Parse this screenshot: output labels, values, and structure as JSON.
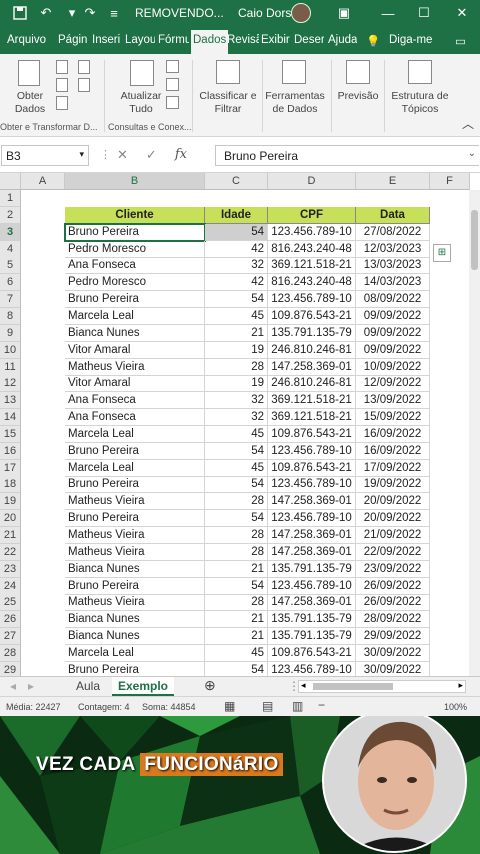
{
  "window": {
    "title": "REMOVENDO...",
    "user": "Caio Dors"
  },
  "tabs": [
    "Arquivo",
    "Págin",
    "Inseri",
    "Layou",
    "Fórmu",
    "Dados",
    "Revisã",
    "Exibir",
    "Deser",
    "Ajuda",
    "Diga-me"
  ],
  "ribbon": {
    "obter_dados": "Obter Dados",
    "atualizar_tudo": "Atualizar Tudo",
    "classificar": "Classificar e Filtrar",
    "ferramentas": "Ferramentas de Dados",
    "previsao": "Previsão",
    "estrutura": "Estrutura de Tópicos",
    "group_obter": "Obter e Transformar D...",
    "group_consultas": "Consultas e Conex..."
  },
  "formula_bar": {
    "name_box": "B3",
    "content": "Bruno Pereira"
  },
  "columns": [
    "A",
    "B",
    "C",
    "D",
    "E",
    "F"
  ],
  "table": {
    "headers": [
      "Cliente",
      "Idade",
      "CPF",
      "Data"
    ],
    "rows": [
      [
        "Bruno Pereira",
        "54",
        "123.456.789-10",
        "27/08/2022"
      ],
      [
        "Pedro Moresco",
        "42",
        "816.243.240-48",
        "12/03/2023"
      ],
      [
        "Ana Fonseca",
        "32",
        "369.121.518-21",
        "13/03/2023"
      ],
      [
        "Pedro Moresco",
        "42",
        "816.243.240-48",
        "14/03/2023"
      ],
      [
        "Bruno Pereira",
        "54",
        "123.456.789-10",
        "08/09/2022"
      ],
      [
        "Marcela Leal",
        "45",
        "109.876.543-21",
        "09/09/2022"
      ],
      [
        "Bianca Nunes",
        "21",
        "135.791.135-79",
        "09/09/2022"
      ],
      [
        "Vitor Amaral",
        "19",
        "246.810.246-81",
        "09/09/2022"
      ],
      [
        "Matheus Vieira",
        "28",
        "147.258.369-01",
        "10/09/2022"
      ],
      [
        "Vitor Amaral",
        "19",
        "246.810.246-81",
        "12/09/2022"
      ],
      [
        "Ana Fonseca",
        "32",
        "369.121.518-21",
        "13/09/2022"
      ],
      [
        "Ana Fonseca",
        "32",
        "369.121.518-21",
        "15/09/2022"
      ],
      [
        "Marcela Leal",
        "45",
        "109.876.543-21",
        "16/09/2022"
      ],
      [
        "Bruno Pereira",
        "54",
        "123.456.789-10",
        "16/09/2022"
      ],
      [
        "Marcela Leal",
        "45",
        "109.876.543-21",
        "17/09/2022"
      ],
      [
        "Bruno Pereira",
        "54",
        "123.456.789-10",
        "19/09/2022"
      ],
      [
        "Matheus Vieira",
        "28",
        "147.258.369-01",
        "20/09/2022"
      ],
      [
        "Bruno Pereira",
        "54",
        "123.456.789-10",
        "20/09/2022"
      ],
      [
        "Matheus Vieira",
        "28",
        "147.258.369-01",
        "21/09/2022"
      ],
      [
        "Matheus Vieira",
        "28",
        "147.258.369-01",
        "22/09/2022"
      ],
      [
        "Bianca Nunes",
        "21",
        "135.791.135-79",
        "23/09/2022"
      ],
      [
        "Bruno Pereira",
        "54",
        "123.456.789-10",
        "26/09/2022"
      ],
      [
        "Matheus Vieira",
        "28",
        "147.258.369-01",
        "26/09/2022"
      ],
      [
        "Bianca Nunes",
        "21",
        "135.791.135-79",
        "28/09/2022"
      ],
      [
        "Bianca Nunes",
        "21",
        "135.791.135-79",
        "29/09/2022"
      ],
      [
        "Marcela Leal",
        "45",
        "109.876.543-21",
        "30/09/2022"
      ],
      [
        "Bruno Pereira",
        "54",
        "123.456.789-10",
        "30/09/2022"
      ]
    ]
  },
  "row_numbers": [
    "1",
    "2",
    "3",
    "4",
    "5",
    "6",
    "7",
    "8",
    "9",
    "10",
    "11",
    "12",
    "13",
    "14",
    "15",
    "16",
    "17",
    "18",
    "19",
    "20",
    "21",
    "22",
    "23",
    "24",
    "25",
    "26",
    "27",
    "28",
    "29"
  ],
  "sheets": [
    "Aula",
    "Exemplo"
  ],
  "active_sheet": "Exemplo",
  "status": {
    "media": "Média: 22427",
    "contagem": "Contagem: 4",
    "soma": "Soma: 44854",
    "zoom": "100%"
  },
  "caption": {
    "prefix": "VEZ CADA ",
    "highlight": "FUNCIONáRIO"
  },
  "colors": {
    "excel_green": "#1e7145",
    "header_fill": "#c6e05a",
    "caption_highlight": "#d9791f"
  }
}
